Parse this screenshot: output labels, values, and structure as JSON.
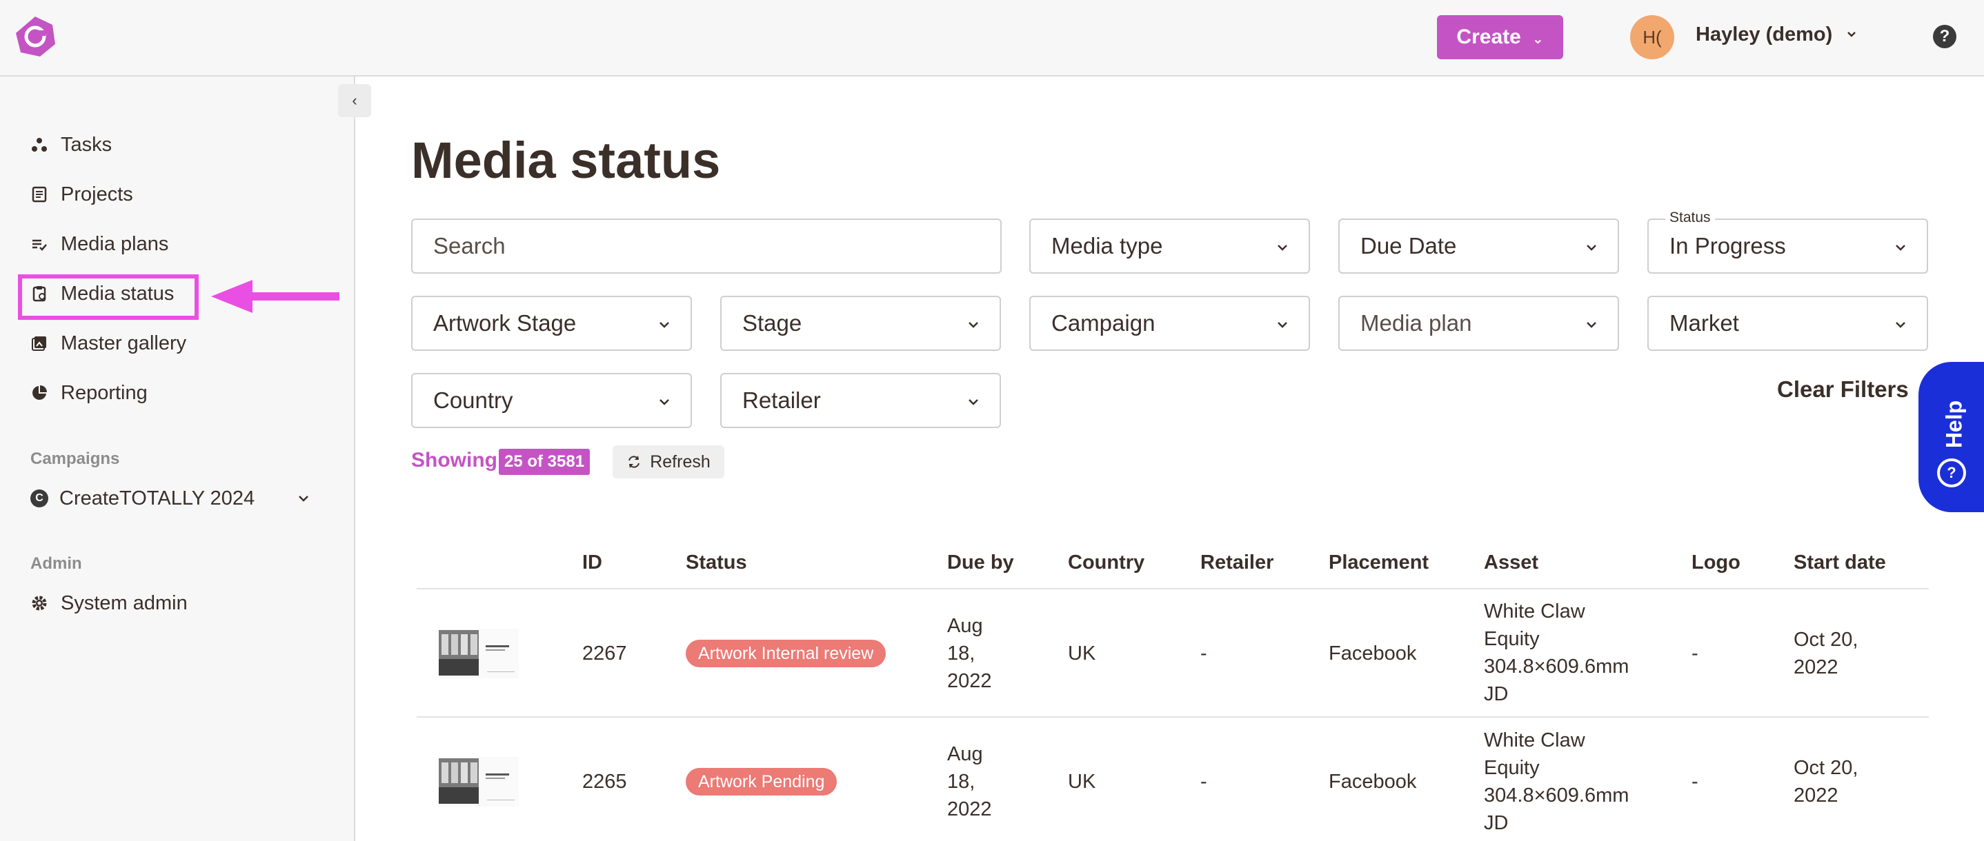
{
  "header": {
    "create_label": "Create",
    "avatar_initials": "H(",
    "user_name": "Hayley (demo)",
    "help_symbol": "?"
  },
  "sidebar": {
    "collapse_symbol": "‹",
    "items": [
      {
        "label": "Tasks",
        "icon": "tasks-icon"
      },
      {
        "label": "Projects",
        "icon": "projects-icon"
      },
      {
        "label": "Media plans",
        "icon": "media-plans-icon"
      },
      {
        "label": "Media status",
        "icon": "clipboard-icon",
        "active": true
      },
      {
        "label": "Master gallery",
        "icon": "gallery-icon"
      },
      {
        "label": "Reporting",
        "icon": "pie-chart-icon"
      }
    ],
    "campaigns_label": "Campaigns",
    "campaign_initial": "C",
    "campaign_name": "CreateTOTALLY 2024",
    "admin_label": "Admin",
    "admin_item": "System admin"
  },
  "main": {
    "title": "Media status",
    "filters": {
      "search_placeholder": "Search",
      "media_type": "Media type",
      "due_date": "Due Date",
      "status_label": "Status",
      "status_value": "In Progress",
      "artwork_stage": "Artwork Stage",
      "stage": "Stage",
      "campaign": "Campaign",
      "media_plan": "Media plan",
      "market": "Market",
      "country": "Country",
      "retailer": "Retailer",
      "clear": "Clear Filters"
    },
    "showing_label": "Showing",
    "count": "25 of 3581",
    "refresh_label": "Refresh",
    "help_tab_label": "Help",
    "table": {
      "headers": [
        "ID",
        "Status",
        "Due by",
        "Country",
        "Retailer",
        "Placement",
        "Asset",
        "Logo",
        "Start date"
      ],
      "rows": [
        {
          "id": "2267",
          "status": "Artwork Internal review",
          "due_lines": [
            "Aug",
            "18,",
            "2022"
          ],
          "country": "UK",
          "retailer": "-",
          "placement": "Facebook",
          "asset_lines": [
            "White Claw",
            "Equity",
            "304.8×609.6mm",
            "JD"
          ],
          "logo": "-",
          "start_lines": [
            "Oct 20,",
            "2022"
          ]
        },
        {
          "id": "2265",
          "status": "Artwork Pending",
          "due_lines": [
            "Aug",
            "18,",
            "2022"
          ],
          "country": "UK",
          "retailer": "-",
          "placement": "Facebook",
          "asset_lines": [
            "White Claw",
            "Equity",
            "304.8×609.6mm",
            "JD"
          ],
          "logo": "-",
          "start_lines": [
            "Oct 20,",
            "2022"
          ]
        }
      ]
    }
  },
  "colors": {
    "brand": "#c454c4",
    "highlight": "#ea4fe4",
    "help": "#1b2fd8",
    "status_pill": "#ec7a75"
  }
}
